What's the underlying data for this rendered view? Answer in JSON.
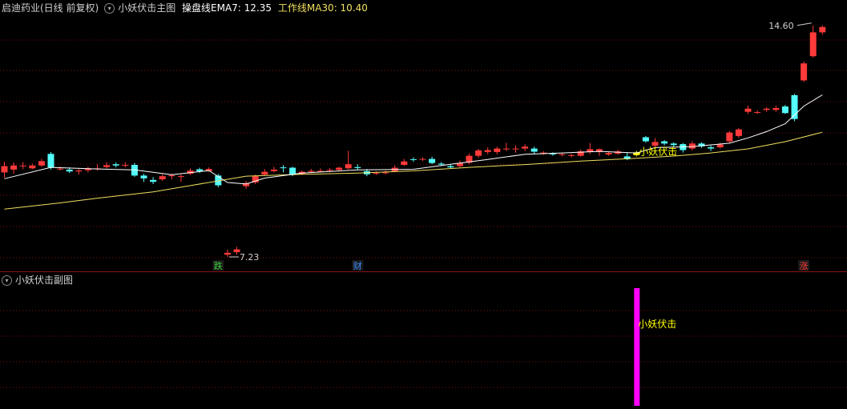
{
  "main_header": {
    "stock_label": "启迪药业(日线 前复权)",
    "indicator_name": "小妖伏击主图",
    "ema_label": "操盘线EMA7: 12.35",
    "ma_label": "工作线MA30: 10.40"
  },
  "sub_header": {
    "indicator_name": "小妖伏击副图"
  },
  "colors": {
    "up": "#ff3a3a",
    "down": "#54fcfc",
    "ema": "#ffffff",
    "ma": "#f0e060",
    "grid": "#7a1010",
    "signal": "#ffff00",
    "sub_bar": "#ff00ff"
  },
  "chart_data": [
    {
      "type": "candlestick",
      "ylim": [
        7.0,
        14.9
      ],
      "max_label": "14.60",
      "min_label": "7.23",
      "markers": [
        {
          "index": 23,
          "text": "跌",
          "color": "#3cd23c"
        },
        {
          "index": 38,
          "text": "财",
          "color": "#3c8cff"
        },
        {
          "index": 86,
          "text": "涨",
          "color": "#ff3a3a"
        }
      ],
      "signal": {
        "index": 68,
        "text": "小妖伏击"
      },
      "candles": [
        [
          9.92,
          10.12,
          10.26,
          9.75
        ],
        [
          10.01,
          10.14,
          10.24,
          9.88
        ],
        [
          10.12,
          10.14,
          10.25,
          10.02
        ],
        [
          10.05,
          10.14,
          10.2,
          10.02
        ],
        [
          10.14,
          10.28,
          10.35,
          10.1
        ],
        [
          10.51,
          10.08,
          10.57,
          10.01
        ],
        [
          10.04,
          10.04,
          10.1,
          9.98
        ],
        [
          10.01,
          9.95,
          10.08,
          9.9
        ],
        [
          9.95,
          9.98,
          10.03,
          9.85
        ],
        [
          9.99,
          10.05,
          10.1,
          9.92
        ],
        [
          10.02,
          10.05,
          10.18,
          9.98
        ],
        [
          10.09,
          10.15,
          10.25,
          10.05
        ],
        [
          10.18,
          10.14,
          10.24,
          10.08
        ],
        [
          10.14,
          10.16,
          10.25,
          10.08
        ],
        [
          10.16,
          9.82,
          10.22,
          9.78
        ],
        [
          9.82,
          9.73,
          9.88,
          9.62
        ],
        [
          9.68,
          9.62,
          9.77,
          9.55
        ],
        [
          9.7,
          9.8,
          9.86,
          9.65
        ],
        [
          9.8,
          9.83,
          9.88,
          9.7
        ],
        [
          9.8,
          9.8,
          9.86,
          9.62
        ],
        [
          9.88,
          9.98,
          10.05,
          9.84
        ],
        [
          10.02,
          9.96,
          10.07,
          9.9
        ],
        [
          9.96,
          10.03,
          10.08,
          9.94
        ],
        [
          9.82,
          9.51,
          9.87,
          9.45
        ],
        [
          7.3,
          7.36,
          7.46,
          7.23
        ],
        [
          7.38,
          7.47,
          7.55,
          7.3
        ],
        [
          9.48,
          9.58,
          9.65,
          9.4
        ],
        [
          9.6,
          9.8,
          9.85,
          9.55
        ],
        [
          9.85,
          9.94,
          10.03,
          9.82
        ],
        [
          9.96,
          10.01,
          10.1,
          9.92
        ],
        [
          10.08,
          10.07,
          10.15,
          9.92
        ],
        [
          10.07,
          9.85,
          10.1,
          9.8
        ],
        [
          9.87,
          9.94,
          9.98,
          9.84
        ],
        [
          9.94,
          9.97,
          10.03,
          9.9
        ],
        [
          9.97,
          9.97,
          10.05,
          9.92
        ],
        [
          9.98,
          10.0,
          10.06,
          9.92
        ],
        [
          10.0,
          10.07,
          10.1,
          9.95
        ],
        [
          10.05,
          10.18,
          10.61,
          10.02
        ],
        [
          10.09,
          10.06,
          10.18,
          10.0
        ],
        [
          9.96,
          9.86,
          10.03,
          9.8
        ],
        [
          9.88,
          9.9,
          9.96,
          9.84
        ],
        [
          9.9,
          9.92,
          9.98,
          9.86
        ],
        [
          9.96,
          10.07,
          10.15,
          9.92
        ],
        [
          10.16,
          10.27,
          10.35,
          10.12
        ],
        [
          10.34,
          10.33,
          10.4,
          10.26
        ],
        [
          10.33,
          10.35,
          10.4,
          10.28
        ],
        [
          10.35,
          10.22,
          10.42,
          10.18
        ],
        [
          10.2,
          10.17,
          10.25,
          10.12
        ],
        [
          10.12,
          10.08,
          10.18,
          10.04
        ],
        [
          10.12,
          10.22,
          10.3,
          10.08
        ],
        [
          10.23,
          10.45,
          10.52,
          10.18
        ],
        [
          10.45,
          10.62,
          10.67,
          10.38
        ],
        [
          10.57,
          10.63,
          10.72,
          10.5
        ],
        [
          10.57,
          10.68,
          10.74,
          10.5
        ],
        [
          10.68,
          10.68,
          10.86,
          10.6
        ],
        [
          10.68,
          10.68,
          10.78,
          10.55
        ],
        [
          10.68,
          10.74,
          10.82,
          10.6
        ],
        [
          10.68,
          10.58,
          10.74,
          10.5
        ],
        [
          10.52,
          10.55,
          10.6,
          10.48
        ],
        [
          10.52,
          10.51,
          10.56,
          10.45
        ],
        [
          10.49,
          10.5,
          10.55,
          10.43
        ],
        [
          10.45,
          10.47,
          10.52,
          10.4
        ],
        [
          10.45,
          10.59,
          10.65,
          10.42
        ],
        [
          10.57,
          10.66,
          10.86,
          10.5
        ],
        [
          10.57,
          10.66,
          10.68,
          10.45
        ],
        [
          10.49,
          10.54,
          10.58,
          10.45
        ],
        [
          10.52,
          10.59,
          10.64,
          10.48
        ],
        [
          10.43,
          10.34,
          10.55,
          10.31
        ],
        [
          10.47,
          10.56,
          10.61,
          10.43
        ],
        [
          11.04,
          10.91,
          11.08,
          10.87
        ],
        [
          10.77,
          10.89,
          11.01,
          10.72
        ],
        [
          10.91,
          10.84,
          10.95,
          10.78
        ],
        [
          10.84,
          10.79,
          10.88,
          10.72
        ],
        [
          10.82,
          10.63,
          10.86,
          10.55
        ],
        [
          10.68,
          10.84,
          10.92,
          10.62
        ],
        [
          10.84,
          10.75,
          10.88,
          10.7
        ],
        [
          10.72,
          10.68,
          10.78,
          10.6
        ],
        [
          10.72,
          10.81,
          10.86,
          10.68
        ],
        [
          10.91,
          11.19,
          11.24,
          10.86
        ],
        [
          11.08,
          11.29,
          11.34,
          11.02
        ],
        [
          11.85,
          11.95,
          12.05,
          11.78
        ],
        [
          11.82,
          11.84,
          11.9,
          11.78
        ],
        [
          11.91,
          11.95,
          12.0,
          11.85
        ],
        [
          11.91,
          11.97,
          12.05,
          11.85
        ],
        [
          12.02,
          11.81,
          12.07,
          11.78
        ],
        [
          12.38,
          11.62,
          12.42,
          11.55
        ],
        [
          12.85,
          13.39,
          13.45,
          12.8
        ],
        [
          13.62,
          14.38,
          14.6,
          13.58
        ],
        [
          14.38,
          14.55,
          14.6,
          14.3
        ]
      ],
      "ema": [
        [
          0,
          9.72
        ],
        [
          5,
          10.08
        ],
        [
          10,
          10.03
        ],
        [
          14,
          10.0
        ],
        [
          18,
          9.85
        ],
        [
          22,
          9.98
        ],
        [
          24,
          9.6
        ],
        [
          26,
          9.55
        ],
        [
          28,
          9.74
        ],
        [
          32,
          9.9
        ],
        [
          38,
          10.0
        ],
        [
          44,
          10.02
        ],
        [
          48,
          10.18
        ],
        [
          52,
          10.33
        ],
        [
          56,
          10.5
        ],
        [
          60,
          10.54
        ],
        [
          64,
          10.59
        ],
        [
          68,
          10.54
        ],
        [
          70,
          10.71
        ],
        [
          74,
          10.74
        ],
        [
          78,
          10.85
        ],
        [
          80,
          11.02
        ],
        [
          82,
          11.22
        ],
        [
          84,
          11.47
        ],
        [
          86,
          12.03
        ],
        [
          88,
          12.39
        ]
      ],
      "ma": [
        [
          0,
          8.75
        ],
        [
          6,
          8.95
        ],
        [
          10,
          9.1
        ],
        [
          16,
          9.3
        ],
        [
          20,
          9.5
        ],
        [
          26,
          9.8
        ],
        [
          32,
          9.86
        ],
        [
          38,
          9.9
        ],
        [
          44,
          9.97
        ],
        [
          50,
          10.08
        ],
        [
          56,
          10.17
        ],
        [
          62,
          10.28
        ],
        [
          68,
          10.37
        ],
        [
          72,
          10.44
        ],
        [
          76,
          10.54
        ],
        [
          80,
          10.67
        ],
        [
          84,
          10.9
        ],
        [
          88,
          11.2
        ]
      ]
    },
    {
      "type": "bar",
      "signal_index": 68,
      "label": "小妖伏击",
      "ylim": [
        0,
        1
      ],
      "value": 1
    }
  ]
}
